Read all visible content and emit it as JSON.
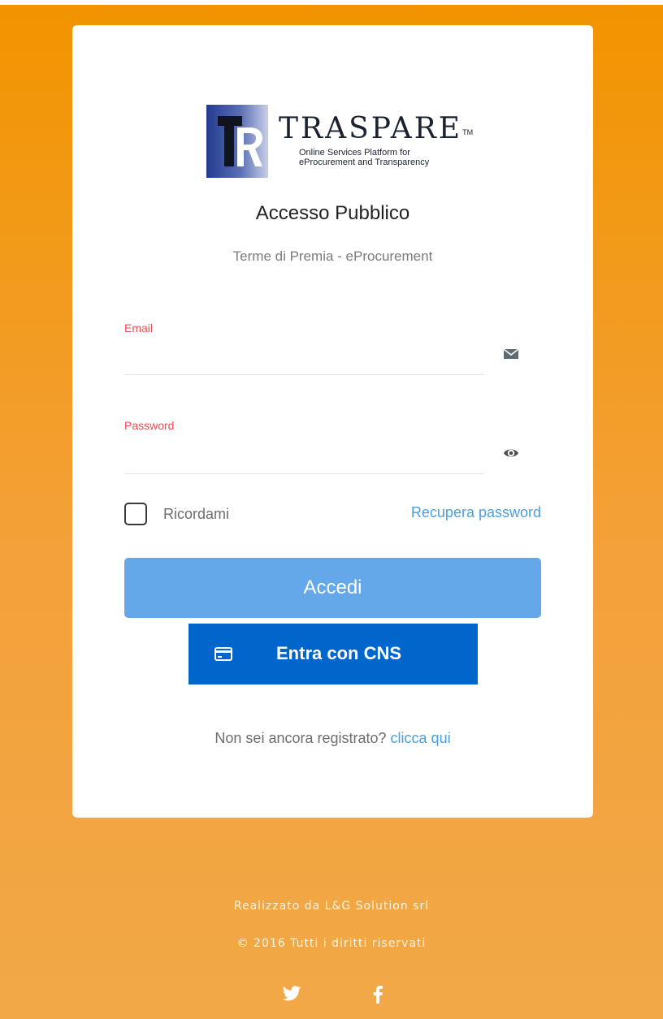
{
  "logo": {
    "brand": "TRASPARE",
    "trademark": "TM",
    "tagline_line1": "Online Services Platform for",
    "tagline_line2": "eProcurement and Transparency"
  },
  "login": {
    "title": "Accesso Pubblico",
    "subtitle": "Terme di Premia - eProcurement",
    "email": {
      "label": "Email",
      "value": "",
      "placeholder": "",
      "icon": "envelope-icon"
    },
    "password": {
      "label": "Password",
      "value": "",
      "placeholder": "",
      "icon": "eye-icon"
    },
    "remember_label": "Ricordami",
    "remember_checked": false,
    "recover_label": "Recupera password",
    "submit_label": "Accedi",
    "cns_label": "Entra con CNS",
    "cns_icon": "credit-card-icon",
    "register_prompt": "Non sei ancora registrato?",
    "register_link": "clicca qui"
  },
  "footer": {
    "made_by": "Realizzato da L&G Solution srl",
    "copyright": "© 2016 Tutti i diritti riservati",
    "social": [
      "twitter-icon",
      "facebook-icon"
    ]
  },
  "colors": {
    "background_top": "#f29400",
    "background_bottom": "#f2a847",
    "primary_button": "#64a8ea",
    "cns_button": "#0066cc",
    "link": "#4b9fe0",
    "field_label": "#ef4d4d"
  }
}
